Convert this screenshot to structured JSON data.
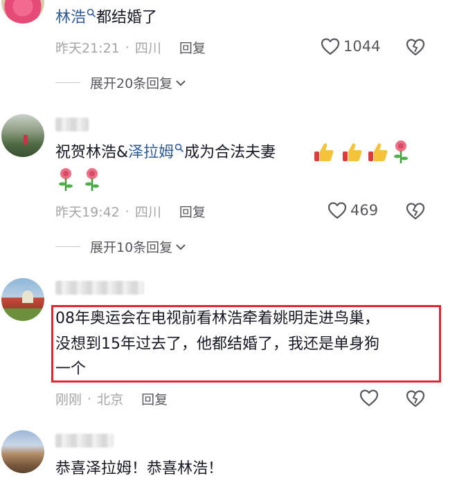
{
  "comments": [
    {
      "text_prefix": "",
      "mention": "林浩",
      "text_suffix": "都结婚了",
      "time": "昨天21:21",
      "separator": "·",
      "location": "四川",
      "reply_label": "回复",
      "likes": "1044",
      "expand_label": "展开20条回复"
    },
    {
      "text_prefix": "祝贺林浩&",
      "mention": "泽拉姆",
      "text_suffix": "成为合法夫妻",
      "time": "昨天19:42",
      "separator": "·",
      "location": "四川",
      "reply_label": "回复",
      "likes": "469",
      "expand_label": "展开10条回复"
    },
    {
      "line1": "08年奥运会在电视前看林浩牵着姚明走进鸟巢，",
      "line2": "没想到15年过去了，他都结婚了，我还是单身狗",
      "line3": "一个",
      "time": "刚刚",
      "separator": "·",
      "location": "北京",
      "reply_label": "回复"
    },
    {
      "text": "恭喜泽拉姆！恭喜林浩！"
    }
  ],
  "colors": {
    "mention": "#2f5a9a",
    "meta": "#a4a4a8",
    "highlight_border": "#e0262e"
  },
  "icons": {
    "like": "heart-outline-icon",
    "dislike": "broken-heart-icon",
    "expand": "chevron-down-icon",
    "search": "search-icon",
    "emoji_thumbs": "thumbs-up-emoji",
    "emoji_rose": "rose-emoji"
  }
}
